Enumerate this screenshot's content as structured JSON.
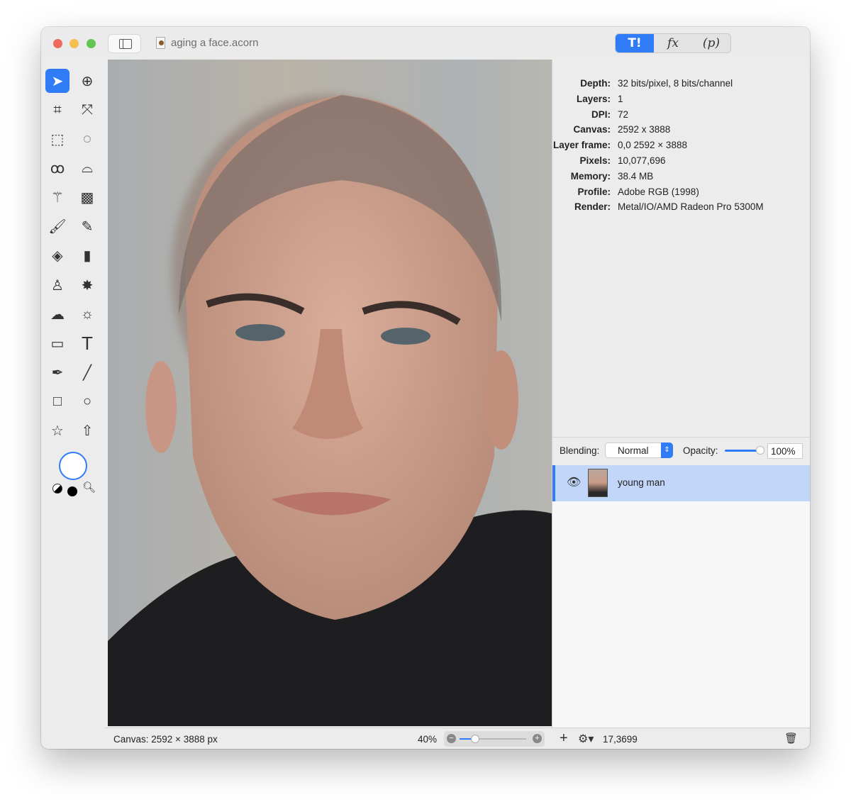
{
  "window": {
    "title": "aging a face.acorn"
  },
  "inspector_tabs": [
    {
      "label": "T!",
      "icon": "tools-icon",
      "selected": true
    },
    {
      "label": "fx",
      "icon": "effects-icon",
      "selected": false
    },
    {
      "label": "(p)",
      "icon": "plugins-icon",
      "selected": false
    }
  ],
  "info": [
    {
      "key": "Depth:",
      "value": "32 bits/pixel, 8 bits/channel"
    },
    {
      "key": "Layers:",
      "value": "1"
    },
    {
      "key": "DPI:",
      "value": "72"
    },
    {
      "key": "Canvas:",
      "value": "2592 x 3888"
    },
    {
      "key": "Layer frame:",
      "value": "0,0 2592 × 3888"
    },
    {
      "key": "Pixels:",
      "value": "10,077,696"
    },
    {
      "key": "Memory:",
      "value": "38.4 MB"
    },
    {
      "key": "Profile:",
      "value": "Adobe RGB (1998)"
    },
    {
      "key": "Render:",
      "value": "Metal/IO/AMD Radeon Pro 5300M"
    }
  ],
  "layer_controls": {
    "blending_label": "Blending:",
    "blending_value": "Normal",
    "opacity_label": "Opacity:",
    "opacity_value": "100%",
    "opacity_fraction": 1.0
  },
  "layers": [
    {
      "name": "young man",
      "visible": true,
      "selected": true
    }
  ],
  "status": {
    "canvas": "Canvas: 2592 × 3888 px",
    "zoom": "40%",
    "zoom_fraction": 0.2,
    "coords": "17,3699"
  },
  "colors": {
    "accent": "#2f7cf6",
    "fill": "#ffffff",
    "stroke": "#000000"
  }
}
